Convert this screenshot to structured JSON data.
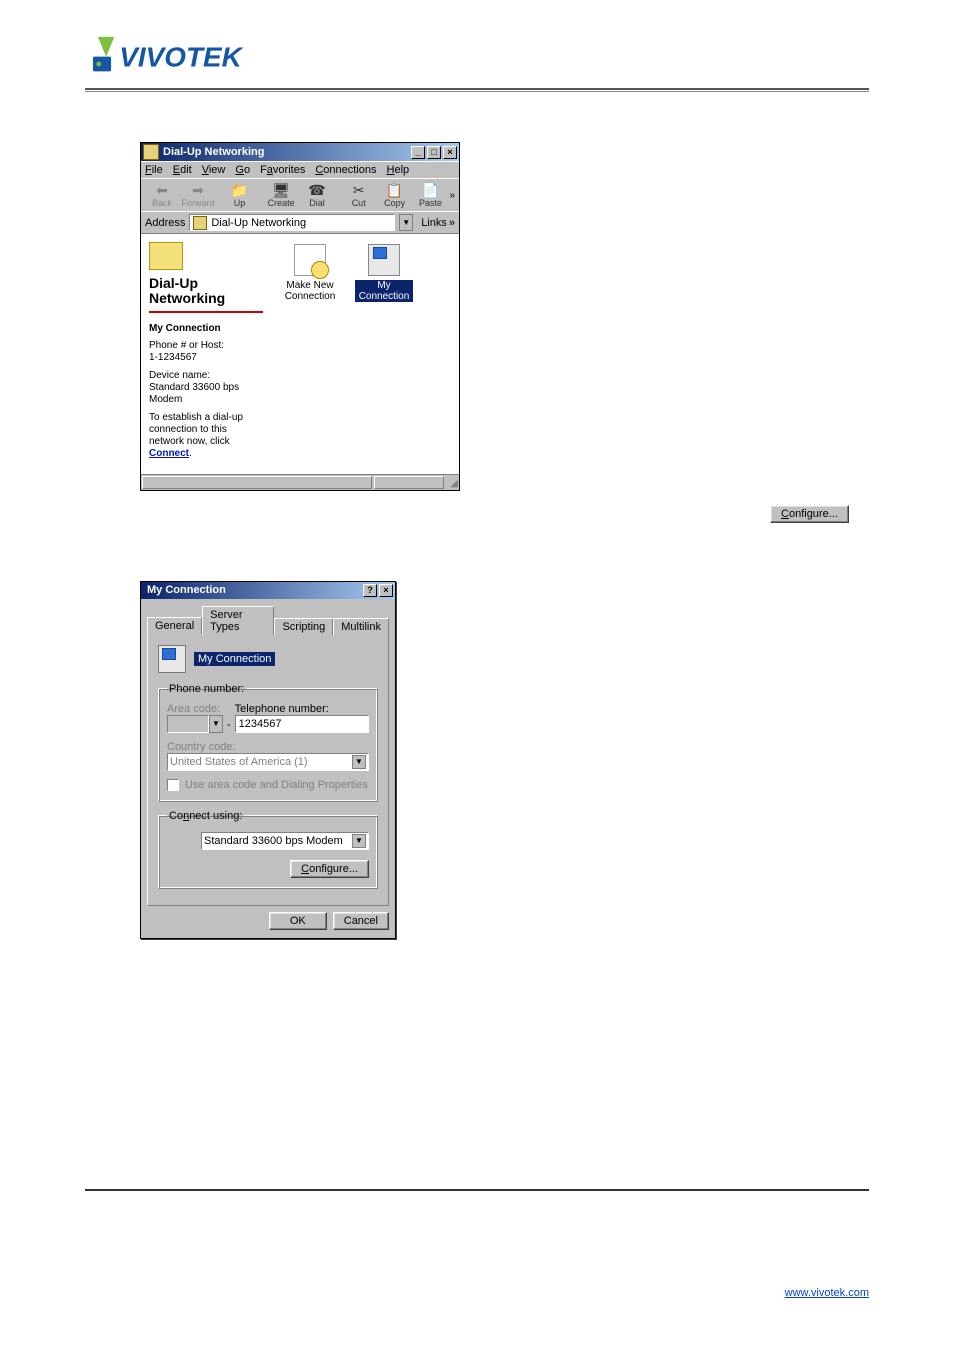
{
  "win1": {
    "title": "Dial-Up Networking",
    "menu": {
      "file": "File",
      "edit": "Edit",
      "view": "View",
      "go": "Go",
      "favorites": "Favorites",
      "connections": "Connections",
      "help": "Help"
    },
    "toolbar": {
      "back": "Back",
      "forward": "Forward",
      "up": "Up",
      "create": "Create",
      "dial": "Dial",
      "cut": "Cut",
      "copy": "Copy",
      "paste": "Paste"
    },
    "address_label": "Address",
    "address_value": "Dial-Up Networking",
    "links": "Links",
    "left": {
      "folder_title": "Dial-Up Networking",
      "section": "My Connection",
      "phone_label": "Phone # or Host:",
      "phone_value": "1-1234567",
      "device_label": "Device name:",
      "device_value": "Standard 33600 bps Modem",
      "hint": "To establish a dial-up connection to this network now, click",
      "connect": "Connect"
    },
    "icons": {
      "new_label": "Make New Connection",
      "my_label": "My Connection"
    }
  },
  "float_configure": "Configure...",
  "dlg": {
    "title": "My Connection",
    "tabs": {
      "general": "General",
      "server": "Server Types",
      "scripting": "Scripting",
      "multilink": "Multilink"
    },
    "conn_name": "My Connection",
    "phone_group": "Phone number:",
    "area_label": "Area code:",
    "area_value": "",
    "tel_label": "Telephone number:",
    "tel_value": "1234567",
    "country_label": "Country code:",
    "country_value": "United States of America (1)",
    "use_area": "Use area code and Dialing Properties",
    "connect_group": "Connect using:",
    "modem_value": "Standard 33600 bps Modem",
    "configure": "Configure...",
    "ok": "OK",
    "cancel": "Cancel"
  },
  "footer_link": "www.vivotek.com",
  "page_number": ""
}
